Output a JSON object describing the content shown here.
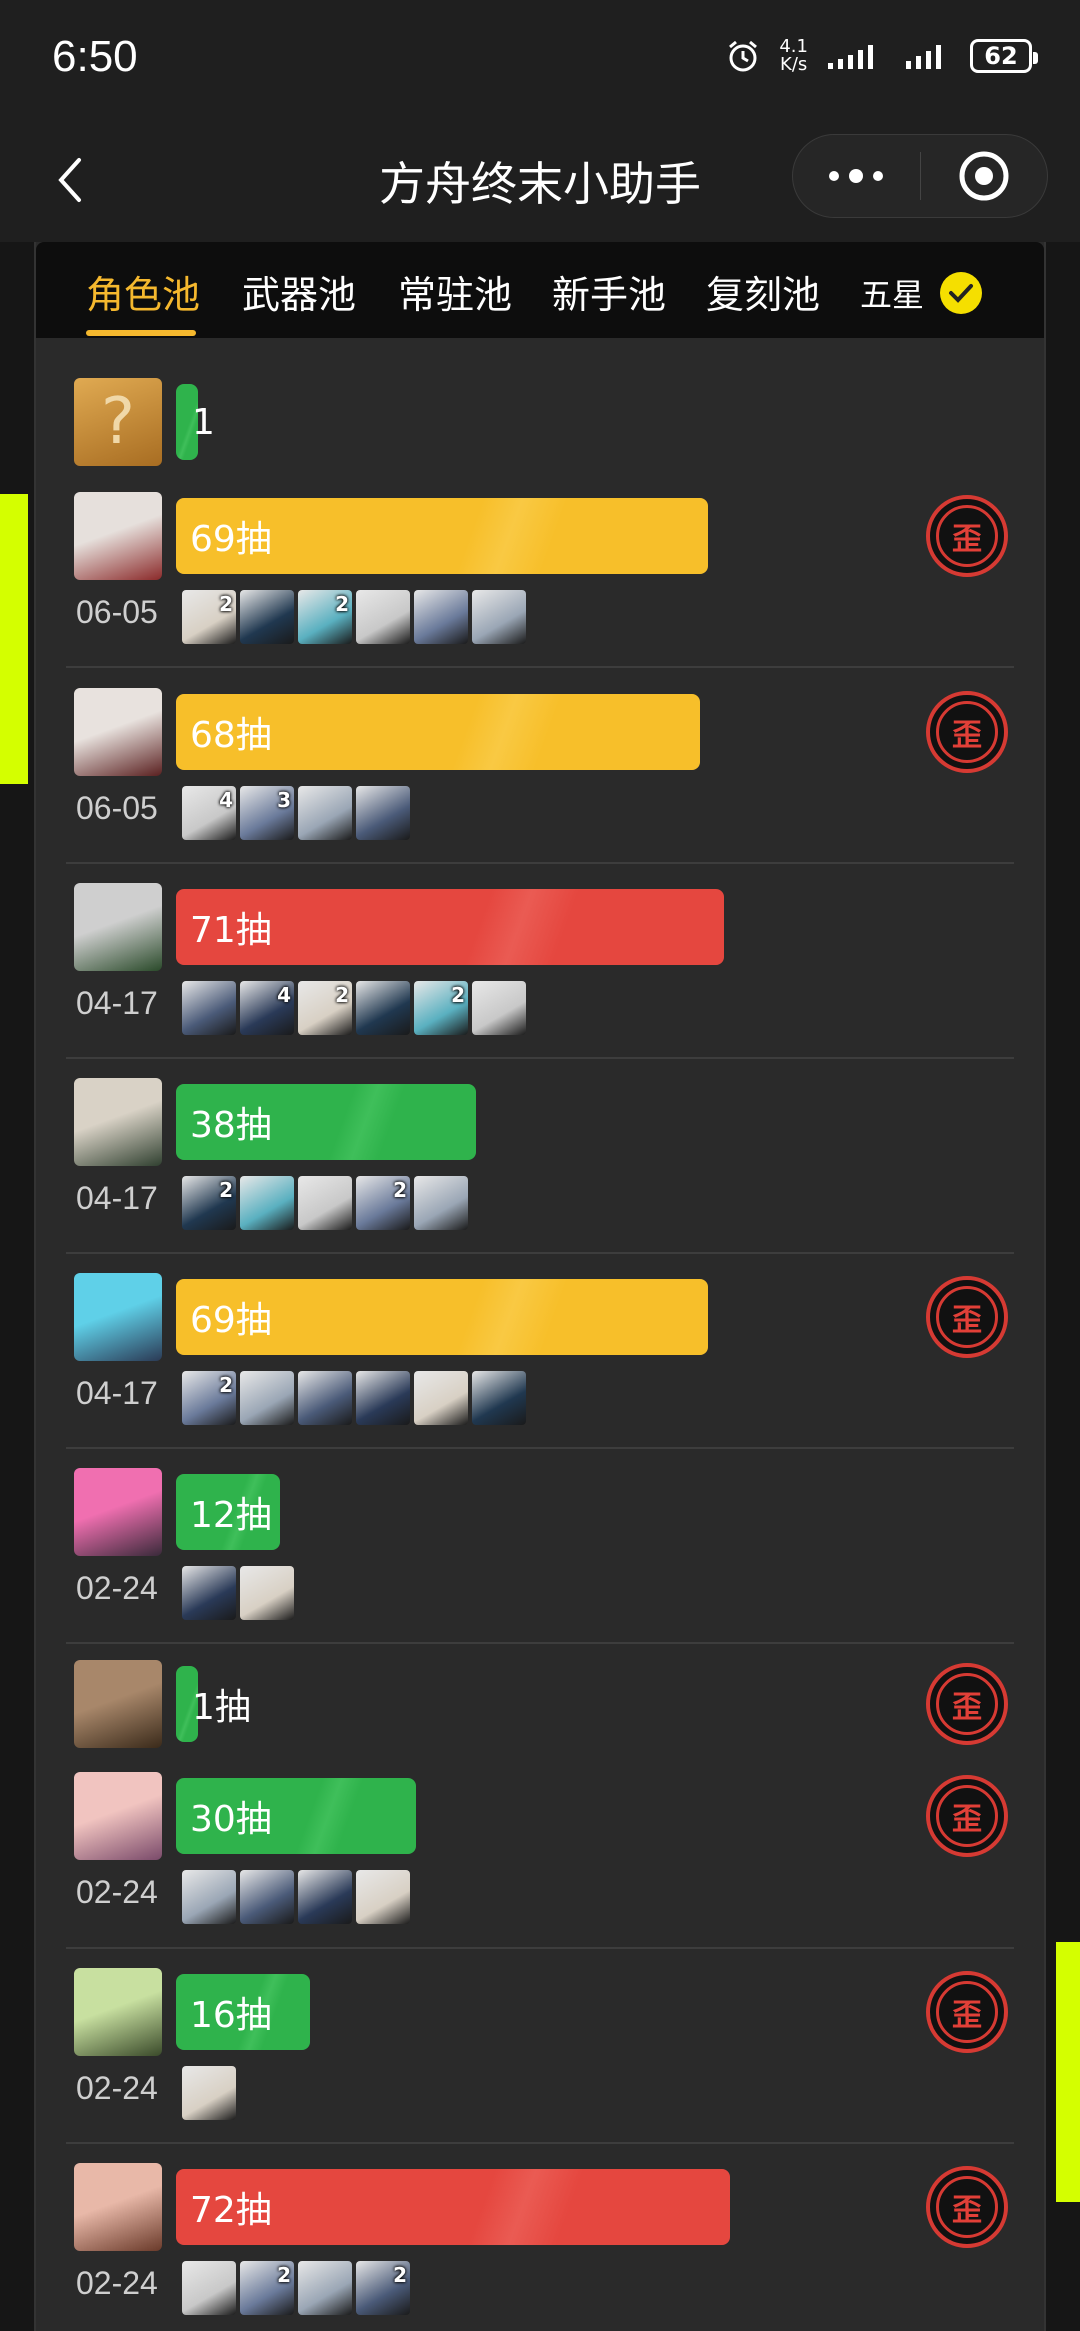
{
  "status": {
    "time": "6:50",
    "speed_top": "4.1",
    "speed_bottom": "K/s",
    "battery": "62"
  },
  "nav": {
    "title": "方舟终末小助手"
  },
  "tabs": [
    "角色池",
    "武器池",
    "常驻池",
    "新手池",
    "复刻池",
    "五星"
  ],
  "badge_text": "歪",
  "unknown_avatar": "?",
  "entries": [
    {
      "pulls": "1",
      "color": "green",
      "fill": 0.02,
      "badge": false,
      "date": "",
      "minis": []
    },
    {
      "pulls": "69抽",
      "color": "yellow",
      "fill": 0.66,
      "badge": true,
      "date": "06-05",
      "minis": [
        "2",
        "",
        "2",
        "",
        "",
        ""
      ]
    },
    {
      "pulls": "68抽",
      "color": "yellow",
      "fill": 0.65,
      "badge": true,
      "date": "06-05",
      "minis": [
        "4",
        "3",
        "",
        ""
      ]
    },
    {
      "pulls": "71抽",
      "color": "red",
      "fill": 0.68,
      "badge": false,
      "date": "04-17",
      "minis": [
        "",
        "4",
        "2",
        "",
        "2",
        ""
      ]
    },
    {
      "pulls": "38抽",
      "color": "green",
      "fill": 0.36,
      "badge": false,
      "date": "04-17",
      "minis": [
        "2",
        "",
        "",
        "2",
        ""
      ]
    },
    {
      "pulls": "69抽",
      "color": "yellow",
      "fill": 0.66,
      "badge": true,
      "date": "04-17",
      "minis": [
        "2",
        "",
        "",
        "",
        "",
        ""
      ]
    },
    {
      "pulls": "12抽",
      "color": "green",
      "fill": 0.11,
      "badge": false,
      "date": "02-24",
      "minis": [
        "",
        ""
      ]
    },
    {
      "pulls": "1抽",
      "color": "green",
      "fill": 0.02,
      "badge": true,
      "date": "",
      "minis": []
    },
    {
      "pulls": "30抽",
      "color": "green",
      "fill": 0.29,
      "badge": true,
      "date": "02-24",
      "minis": [
        "",
        "",
        "",
        ""
      ]
    },
    {
      "pulls": "16抽",
      "color": "green",
      "fill": 0.15,
      "badge": true,
      "date": "02-24",
      "minis": [
        ""
      ]
    },
    {
      "pulls": "72抽",
      "color": "red",
      "fill": 0.69,
      "badge": true,
      "date": "02-24",
      "minis": [
        "",
        "2",
        "",
        "2"
      ]
    }
  ],
  "colors": {
    "accent": "#f5b82e",
    "yellow": "#f7bf2a",
    "red": "#e5473f",
    "green": "#2fb34c",
    "check": "#f5df00"
  }
}
